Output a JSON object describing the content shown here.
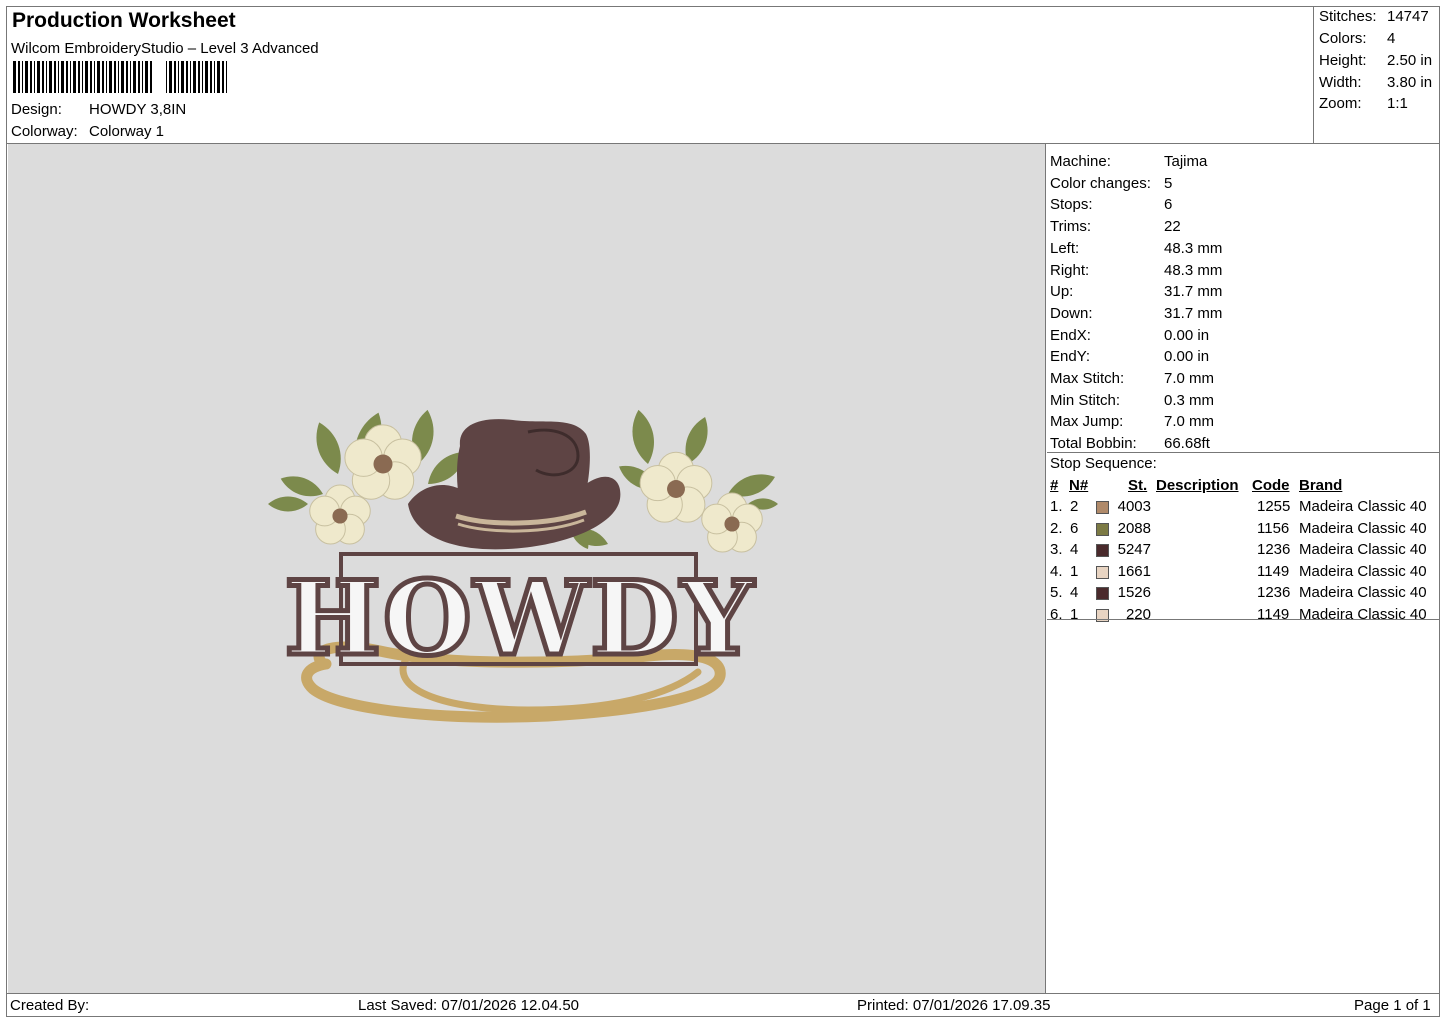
{
  "header": {
    "title": "Production Worksheet",
    "software": "Wilcom EmbroideryStudio – Level 3 Advanced",
    "design_label": "Design:",
    "design_value": "HOWDY 3,8IN",
    "colorway_label": "Colorway:",
    "colorway_value": "Colorway 1"
  },
  "stats": [
    {
      "label": "Stitches:",
      "value": "14747"
    },
    {
      "label": "Colors:",
      "value": "4"
    },
    {
      "label": "Height:",
      "value": "2.50 in"
    },
    {
      "label": "Width:",
      "value": "3.80 in"
    },
    {
      "label": "Zoom:",
      "value": "1:1"
    }
  ],
  "machine_info": [
    {
      "label": "Machine:",
      "value": "Tajima"
    },
    {
      "label": "Color changes:",
      "value": "5"
    },
    {
      "label": "Stops:",
      "value": "6"
    },
    {
      "label": "Trims:",
      "value": "22"
    },
    {
      "label": "Left:",
      "value": "48.3 mm"
    },
    {
      "label": "Right:",
      "value": "48.3 mm"
    },
    {
      "label": "Up:",
      "value": "31.7 mm"
    },
    {
      "label": "Down:",
      "value": "31.7 mm"
    },
    {
      "label": "EndX:",
      "value": "0.00 in"
    },
    {
      "label": "EndY:",
      "value": "0.00 in"
    },
    {
      "label": "Max Stitch:",
      "value": "7.0 mm"
    },
    {
      "label": "Min Stitch:",
      "value": "0.3 mm"
    },
    {
      "label": "Max Jump:",
      "value": "7.0 mm"
    },
    {
      "label": "Total Bobbin:",
      "value": "66.68ft"
    }
  ],
  "stop_sequence": {
    "title": "Stop Sequence:",
    "columns": [
      "#",
      "N#",
      "St.",
      "Description",
      "Code",
      "Brand"
    ],
    "rows": [
      {
        "num": "1.",
        "n": "2",
        "color": "#b08a6a",
        "st": "4003",
        "code": "1255",
        "brand": "Madeira Classic 40"
      },
      {
        "num": "2.",
        "n": "6",
        "color": "#7c7a44",
        "st": "2088",
        "code": "1156",
        "brand": "Madeira Classic 40"
      },
      {
        "num": "3.",
        "n": "4",
        "color": "#4a2a2c",
        "st": "5247",
        "code": "1236",
        "brand": "Madeira Classic 40"
      },
      {
        "num": "4.",
        "n": "1",
        "color": "#e8d4c2",
        "st": "1661",
        "code": "1149",
        "brand": "Madeira Classic 40"
      },
      {
        "num": "5.",
        "n": "4",
        "color": "#4a2a2c",
        "st": "1526",
        "code": "1236",
        "brand": "Madeira Classic 40"
      },
      {
        "num": "6.",
        "n": "1",
        "color": "#e8d4c2",
        "st": "220",
        "code": "1149",
        "brand": "Madeira Classic 40"
      }
    ]
  },
  "design": {
    "text": "HOWDY",
    "hat_color": "#5e4444",
    "rope_color": "#c8a868",
    "flower_color": "#efe9cc",
    "leaf_color": "#7c8a4c",
    "text_outline_color": "#5e4444"
  },
  "footer": {
    "created_by": "Created By:",
    "last_saved": "Last Saved: 07/01/2026 12.04.50",
    "printed": "Printed: 07/01/2026 17.09.35",
    "page": "Page 1 of 1"
  }
}
